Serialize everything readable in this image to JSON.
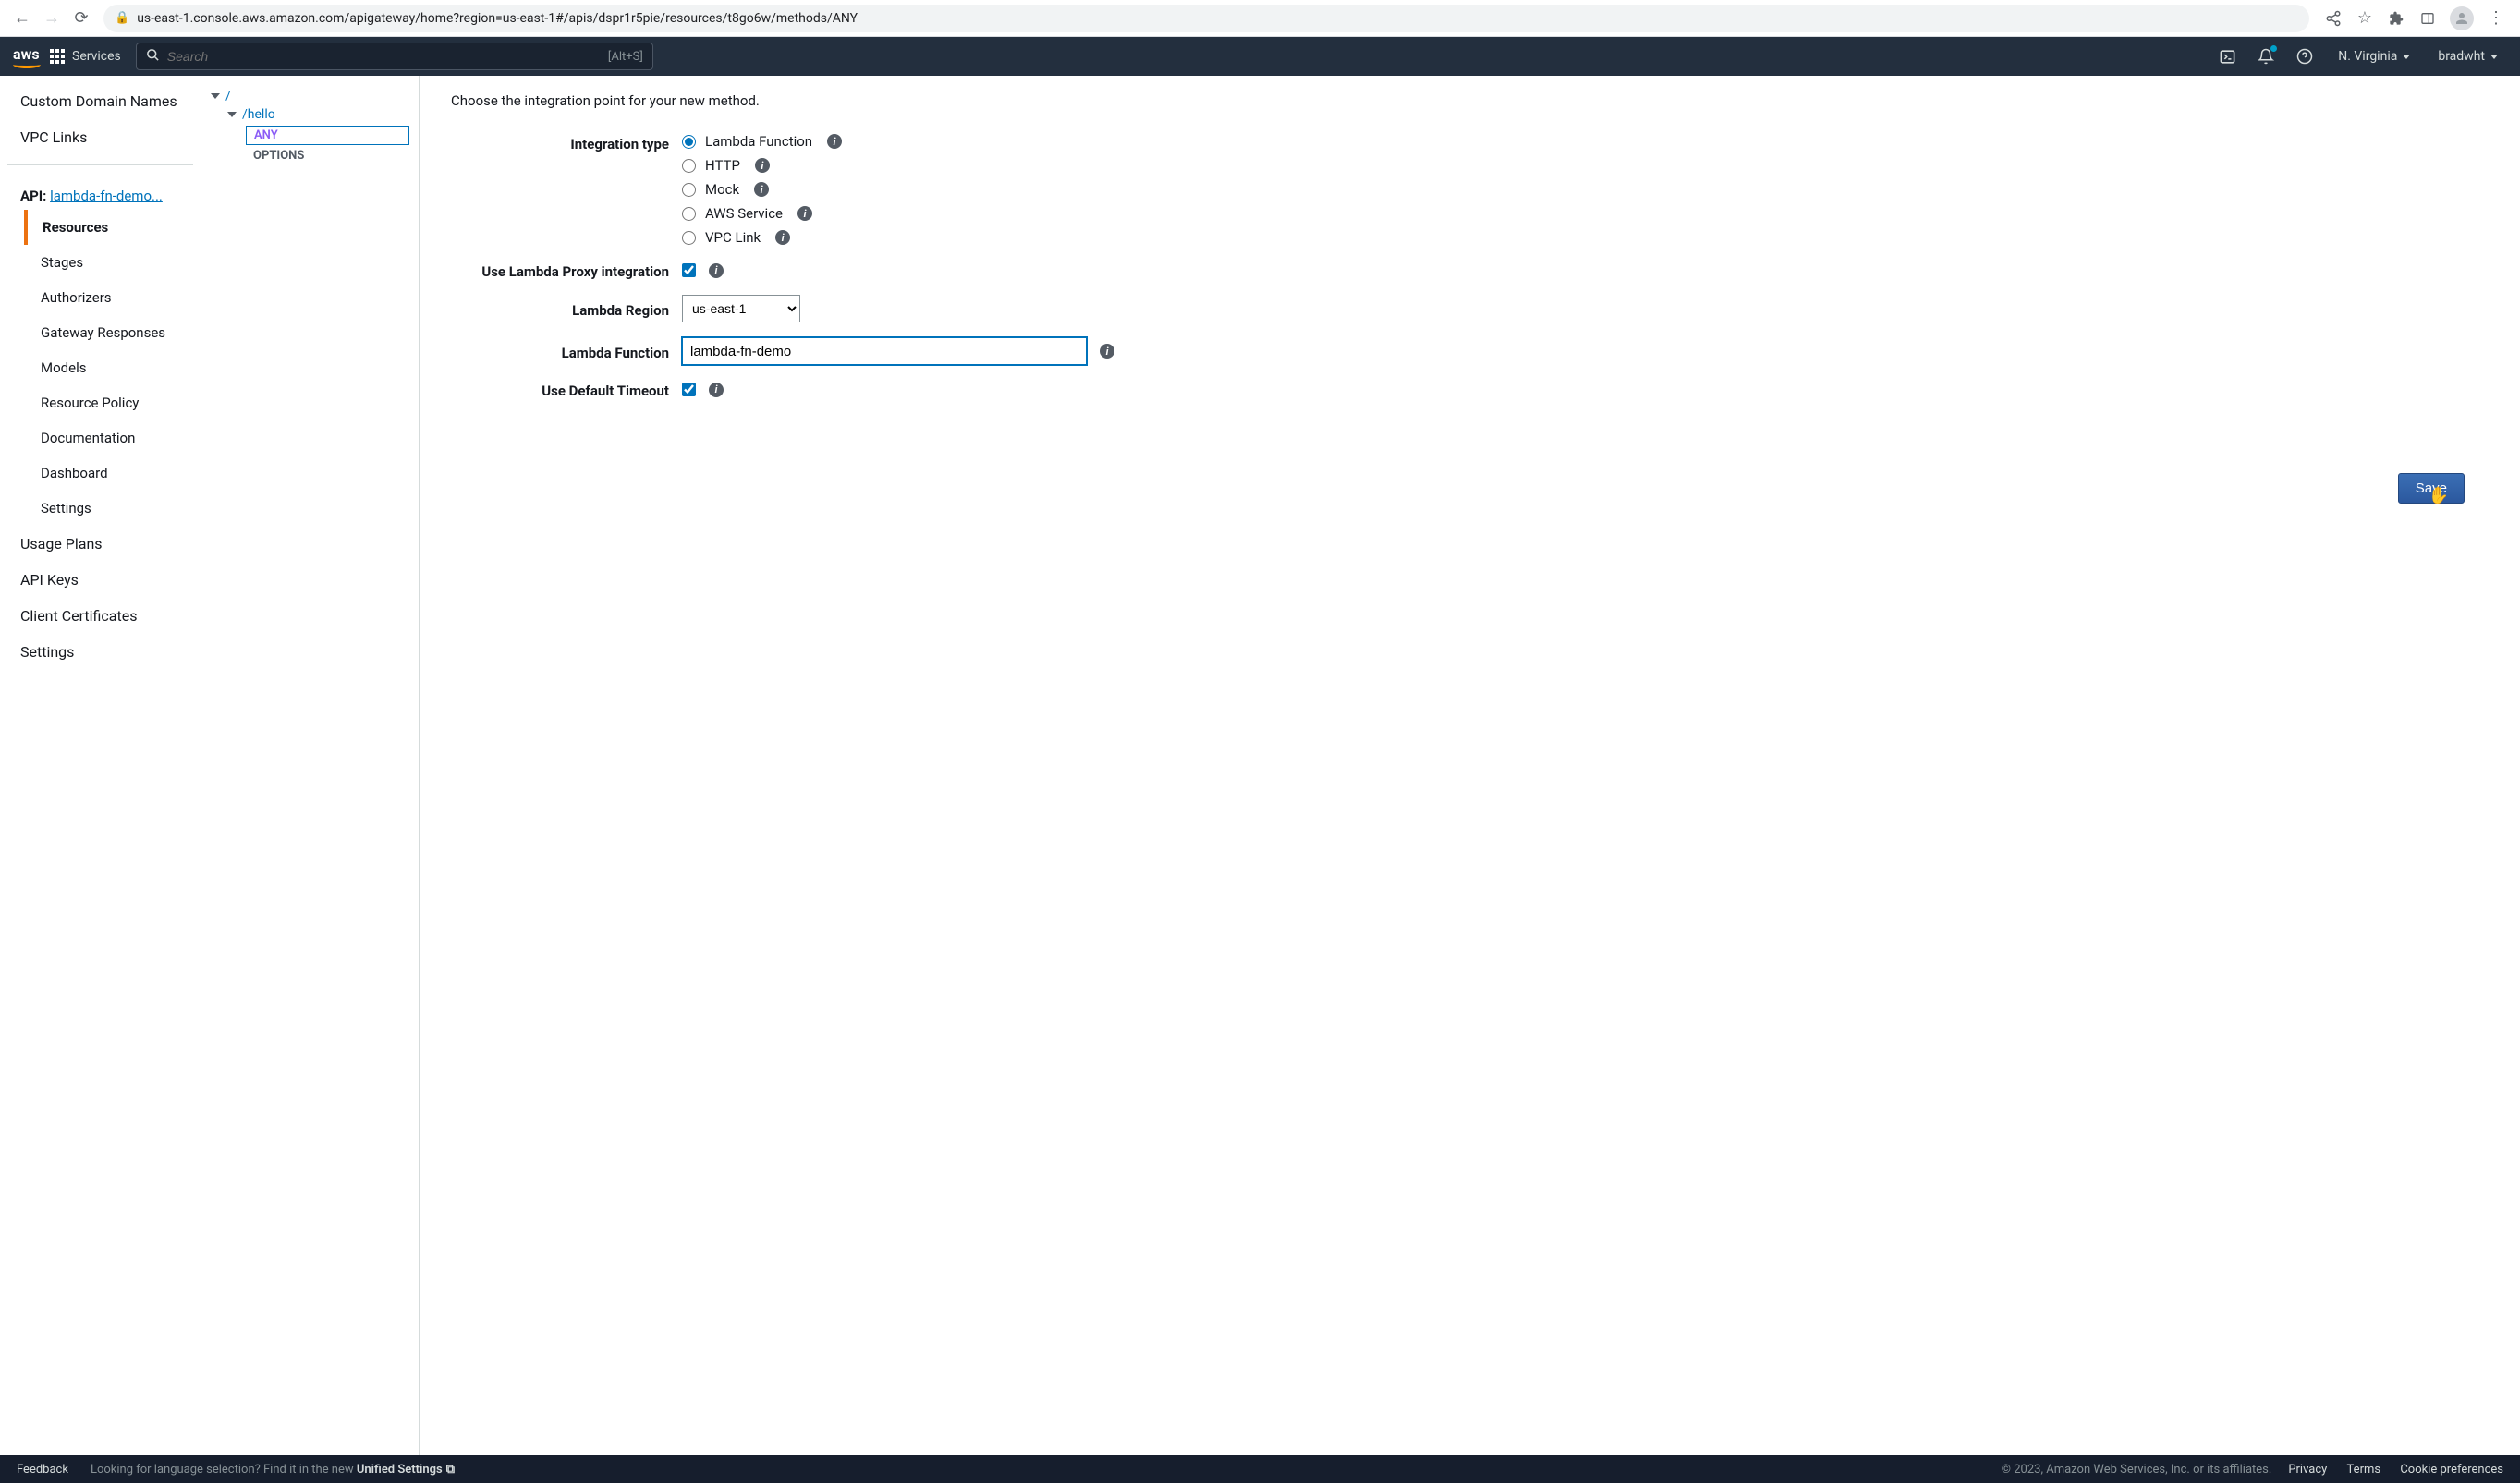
{
  "browser": {
    "url": "us-east-1.console.aws.amazon.com/apigateway/home?region=us-east-1#/apis/dspr1r5pie/resources/t8go6w/methods/ANY"
  },
  "topbar": {
    "services": "Services",
    "search_placeholder": "Search",
    "search_shortcut": "[Alt+S]",
    "region": "N. Virginia",
    "user": "bradwht"
  },
  "sidebar": {
    "items_top": [
      "Custom Domain Names",
      "VPC Links"
    ],
    "api_prefix": "API: ",
    "api_name": "lambda-fn-demo...",
    "api_items": [
      "Resources",
      "Stages",
      "Authorizers",
      "Gateway Responses",
      "Models",
      "Resource Policy",
      "Documentation",
      "Dashboard",
      "Settings"
    ],
    "items_bottom": [
      "Usage Plans",
      "API Keys",
      "Client Certificates",
      "Settings"
    ]
  },
  "tree": {
    "root": "/",
    "child": "/hello",
    "methods": [
      "ANY",
      "OPTIONS"
    ]
  },
  "content": {
    "instruction": "Choose the integration point for your new method.",
    "labels": {
      "integration_type": "Integration type",
      "proxy": "Use Lambda Proxy integration",
      "region": "Lambda Region",
      "function": "Lambda Function",
      "timeout": "Use Default Timeout"
    },
    "integration_options": [
      "Lambda Function",
      "HTTP",
      "Mock",
      "AWS Service",
      "VPC Link"
    ],
    "selected_integration": "Lambda Function",
    "proxy_checked": true,
    "region_value": "us-east-1",
    "function_value": "lambda-fn-demo",
    "timeout_checked": true,
    "save": "Save"
  },
  "footer": {
    "feedback": "Feedback",
    "lang_prompt": "Looking for language selection? Find it in the new ",
    "unified": "Unified Settings",
    "copyright": "© 2023, Amazon Web Services, Inc. or its affiliates.",
    "links": [
      "Privacy",
      "Terms",
      "Cookie preferences"
    ]
  }
}
